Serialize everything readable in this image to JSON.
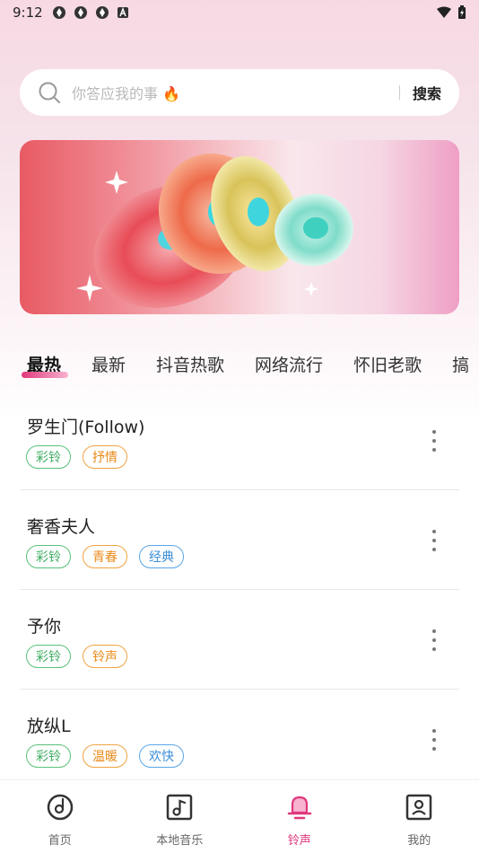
{
  "status_bar": {
    "time": "9:12",
    "notification_icons": [
      "app-icon",
      "app-icon",
      "app-icon",
      "a-icon"
    ],
    "right_icons": [
      "wifi-icon",
      "battery-icon"
    ]
  },
  "search": {
    "placeholder": "你答应我的事 🔥",
    "button_label": "搜索"
  },
  "tabs": [
    {
      "label": "最热",
      "active": true
    },
    {
      "label": "最新",
      "active": false
    },
    {
      "label": "抖音热歌",
      "active": false
    },
    {
      "label": "网络流行",
      "active": false
    },
    {
      "label": "怀旧老歌",
      "active": false
    },
    {
      "label": "搞",
      "active": false
    }
  ],
  "songs": [
    {
      "title": "罗生门(Follow)",
      "tags": [
        {
          "text": "彩铃",
          "color": "green"
        },
        {
          "text": "抒情",
          "color": "orange"
        }
      ]
    },
    {
      "title": "奢香夫人",
      "tags": [
        {
          "text": "彩铃",
          "color": "green"
        },
        {
          "text": "青春",
          "color": "orange"
        },
        {
          "text": "经典",
          "color": "blue"
        }
      ]
    },
    {
      "title": "予你",
      "tags": [
        {
          "text": "彩铃",
          "color": "green"
        },
        {
          "text": "铃声",
          "color": "orange"
        }
      ]
    },
    {
      "title": "放纵L",
      "tags": [
        {
          "text": "彩铃",
          "color": "green"
        },
        {
          "text": "温暖",
          "color": "orange"
        },
        {
          "text": "欢快",
          "color": "blue"
        }
      ]
    }
  ],
  "bottom_nav": [
    {
      "label": "首页",
      "icon": "home-disc-icon",
      "active": false
    },
    {
      "label": "本地音乐",
      "icon": "music-note-icon",
      "active": false
    },
    {
      "label": "铃声",
      "icon": "bell-icon",
      "active": true
    },
    {
      "label": "我的",
      "icon": "profile-icon",
      "active": false
    }
  ],
  "colors": {
    "accent": "#e0387c",
    "tag_green": "#3fae63",
    "tag_orange": "#e98a18",
    "tag_blue": "#3b8fd8"
  }
}
